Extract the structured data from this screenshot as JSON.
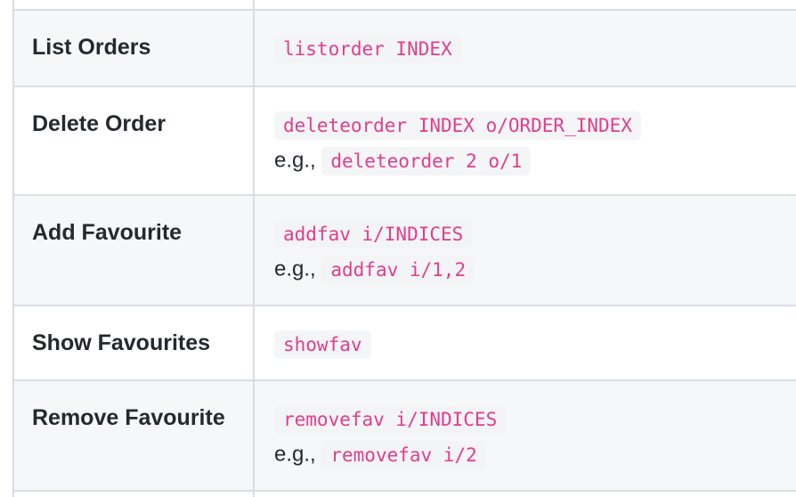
{
  "commands": [
    {
      "name": "List Orders",
      "format": "listorder INDEX",
      "example_prefix": "",
      "example": ""
    },
    {
      "name": "Delete Order",
      "format": "deleteorder INDEX o/ORDER_INDEX",
      "example_prefix": "e.g.,",
      "example": "deleteorder 2 o/1"
    },
    {
      "name": "Add Favourite",
      "format": "addfav i/INDICES",
      "example_prefix": "e.g.,",
      "example": "addfav i/1,2"
    },
    {
      "name": "Show Favourites",
      "format": "showfav",
      "example_prefix": "",
      "example": ""
    },
    {
      "name": "Remove Favourite",
      "format": "removefav i/INDICES",
      "example_prefix": "e.g.,",
      "example": "removefav i/2"
    }
  ]
}
